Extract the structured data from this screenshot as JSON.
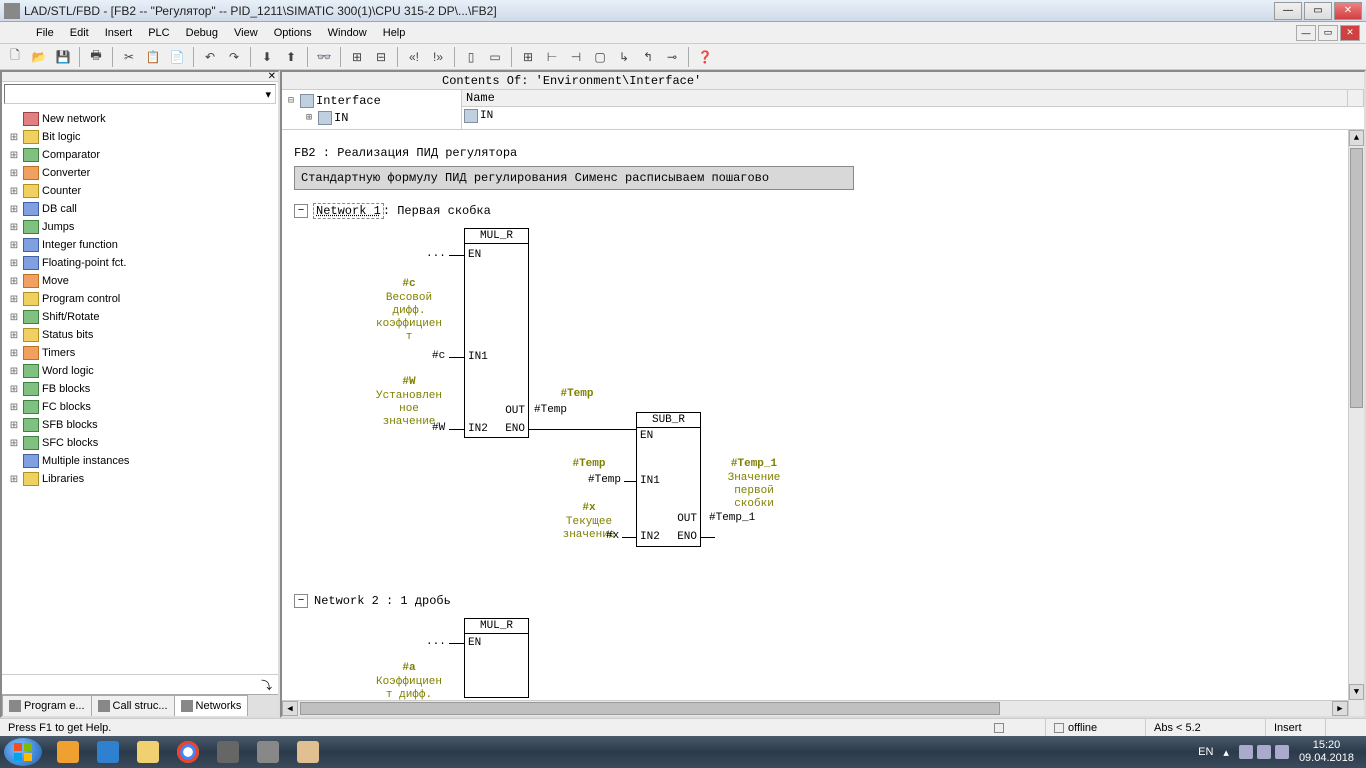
{
  "titlebar": {
    "text": "LAD/STL/FBD  - [FB2 -- \"Регулятор\" -- PID_1211\\SIMATIC 300(1)\\CPU 315-2 DP\\...\\FB2]"
  },
  "menu": {
    "file": "File",
    "edit": "Edit",
    "insert": "Insert",
    "plc": "PLC",
    "debug": "Debug",
    "view": "View",
    "options": "Options",
    "window": "Window",
    "help": "Help"
  },
  "tree": [
    {
      "exp": "",
      "icon": "ic-red",
      "label": "New network"
    },
    {
      "exp": "+",
      "icon": "ic-yel",
      "label": "Bit logic"
    },
    {
      "exp": "+",
      "icon": "ic-grn",
      "label": "Comparator"
    },
    {
      "exp": "+",
      "icon": "ic-org",
      "label": "Converter"
    },
    {
      "exp": "+",
      "icon": "ic-yel",
      "label": "Counter"
    },
    {
      "exp": "+",
      "icon": "ic-blu",
      "label": "DB call"
    },
    {
      "exp": "+",
      "icon": "ic-grn",
      "label": "Jumps"
    },
    {
      "exp": "+",
      "icon": "ic-blu",
      "label": "Integer function"
    },
    {
      "exp": "+",
      "icon": "ic-blu",
      "label": "Floating-point fct."
    },
    {
      "exp": "+",
      "icon": "ic-org",
      "label": "Move"
    },
    {
      "exp": "+",
      "icon": "ic-yel",
      "label": "Program control"
    },
    {
      "exp": "+",
      "icon": "ic-grn",
      "label": "Shift/Rotate"
    },
    {
      "exp": "+",
      "icon": "ic-yel",
      "label": "Status bits"
    },
    {
      "exp": "+",
      "icon": "ic-org",
      "label": "Timers"
    },
    {
      "exp": "+",
      "icon": "ic-grn",
      "label": "Word logic"
    },
    {
      "exp": "+",
      "icon": "ic-grn",
      "label": "FB blocks"
    },
    {
      "exp": "+",
      "icon": "ic-grn",
      "label": "FC blocks"
    },
    {
      "exp": "+",
      "icon": "ic-grn",
      "label": "SFB blocks"
    },
    {
      "exp": "+",
      "icon": "ic-grn",
      "label": "SFC blocks"
    },
    {
      "exp": "",
      "icon": "ic-blu",
      "label": "Multiple instances"
    },
    {
      "exp": "+",
      "icon": "ic-yel",
      "label": "Libraries"
    }
  ],
  "left_tabs": {
    "program": "Program e...",
    "call": "Call struc...",
    "networks": "Networks"
  },
  "contents_of": "Contents Of: 'Environment\\Interface'",
  "interface": {
    "root": "Interface",
    "in": "IN",
    "name_hdr": "Name",
    "in_val": "IN"
  },
  "editor": {
    "fb_title": "FB2 : Реализация ПИД регулятора",
    "fb_desc": "Стандартную формулу ПИД регулирования Сименс расписываем пошагово",
    "net1": "Network 1",
    "net1_title": ": Первая скобка",
    "net2": "Network 2 : 1 дробь",
    "block_mulr": "MUL_R",
    "block_subr": "SUB_R",
    "en": "EN",
    "eno": "ENO",
    "in1": "IN1",
    "in2": "IN2",
    "out": "OUT",
    "dots": "...",
    "sig_c": "#c",
    "sig_c_txt": "Весовой\nдифф.\nкоэффициен\nт",
    "var_c": "#c",
    "sig_w": "#W",
    "sig_w_txt": "Установлен\nное\nзначение",
    "var_w": "#W",
    "sig_temp": "#Temp",
    "var_temp": "#Temp",
    "sig_x": "#x",
    "sig_x_txt": "Текущее\nзначение",
    "var_x": "#x",
    "sig_temp1": "#Temp_1",
    "sig_temp1_txt": "Значение\nпервой\nскобки",
    "var_temp1": "#Temp_1",
    "sig_a": "#a",
    "sig_a_txt": "Коэффициен\nт дифф."
  },
  "statusbar": {
    "help": "Press F1 to get Help.",
    "offline": "offline",
    "abs": "Abs < 5.2",
    "insert": "Insert"
  },
  "tray": {
    "lang": "EN",
    "time": "15:20",
    "date": "09.04.2018"
  }
}
